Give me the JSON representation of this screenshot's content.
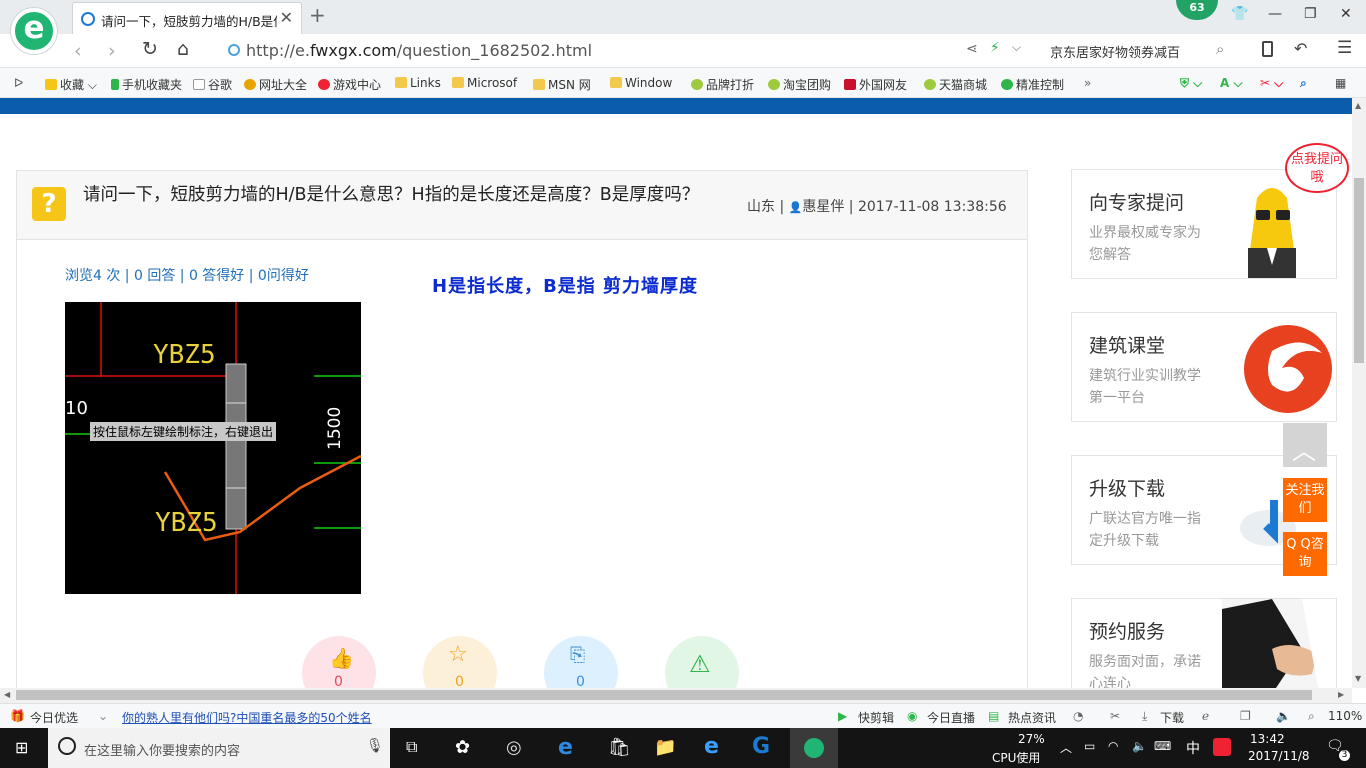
{
  "browser": {
    "tab_title": "请问一下，短肢剪力墙的H/B是什么意思",
    "notification_count": "63",
    "url_prefix": "http://e.",
    "url_domain": "fwxgx.com",
    "url_path": "/question_1682502.html",
    "search_text": "京东居家好物领券减百",
    "bookmarks": [
      "收藏",
      "手机收藏夹",
      "谷歌",
      "网址大全",
      "游戏中心",
      "Links",
      "Microsof",
      "MSN 网",
      "Window",
      "品牌打折",
      "淘宝团购",
      "外国网友",
      "天猫商城",
      "精准控制"
    ],
    "zoom": "110%"
  },
  "question": {
    "title": "请问一下，短肢剪力墙的H/B是什么意思？H指的是长度还是高度？B是厚度吗？",
    "location": "山东",
    "user": "惠星伴",
    "datetime": "2017-11-08 13:38:56",
    "stats": "浏览4 次 | 0 回答 | 0 答得好 | 0问得好",
    "answer": "H是指长度，B是指 剪力墙厚度"
  },
  "cad": {
    "label_top": "YBZ5",
    "label_bottom": "YBZ5",
    "tooltip": "按住鼠标左键绘制标注，右键退出",
    "dim_left": "10",
    "dim_right": "1500"
  },
  "actions": [
    {
      "icon": "thumbs-up-icon",
      "count": "0",
      "color": "#fde3e7"
    },
    {
      "icon": "star-icon",
      "count": "0",
      "color": "#fdf0d9"
    },
    {
      "icon": "share-icon",
      "count": "0",
      "color": "#dcf0fd"
    },
    {
      "icon": "warning-icon",
      "count": "",
      "color": "#e2f6e6"
    }
  ],
  "sidebar": {
    "bubble": "点我提问哦",
    "cards": [
      {
        "title": "向专家提问",
        "desc": "业界最权威专家为您解答"
      },
      {
        "title": "建筑课堂",
        "desc": "建筑行业实训教学第一平台"
      },
      {
        "title": "升级下载",
        "desc": "广联达官方唯一指定升级下载"
      },
      {
        "title": "预约服务",
        "desc": "服务面对面，承诺心连心"
      }
    ],
    "follow": "关注我们",
    "qq": "Q Q咨询"
  },
  "statusbar": {
    "today": "今日优选",
    "news": "你的熟人里有他们吗?中国重名最多的50个姓名",
    "items": [
      "快剪辑",
      "今日直播",
      "热点资讯",
      "下载"
    ]
  },
  "taskbar": {
    "search_placeholder": "在这里输入你要搜索的内容",
    "cpu_percent": "27%",
    "cpu_label": "CPU使用",
    "ime": "中",
    "time": "13:42",
    "date": "2017/11/8",
    "notifications": "3"
  }
}
